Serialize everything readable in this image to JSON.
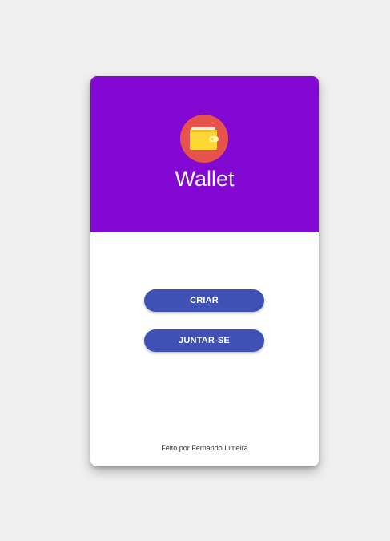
{
  "app": {
    "title": "Wallet",
    "logo_icon": "wallet-icon"
  },
  "actions": {
    "create_label": "CRIAR",
    "join_label": "JUNTAR-SE"
  },
  "footer": {
    "credit": "Feito por Fernando Limeira"
  },
  "colors": {
    "header_background": "#8308d3",
    "logo_circle": "#e6534b",
    "button_background": "#3f51b5",
    "wallet_body": "#fdd835",
    "page_background": "#f0f0f0"
  }
}
